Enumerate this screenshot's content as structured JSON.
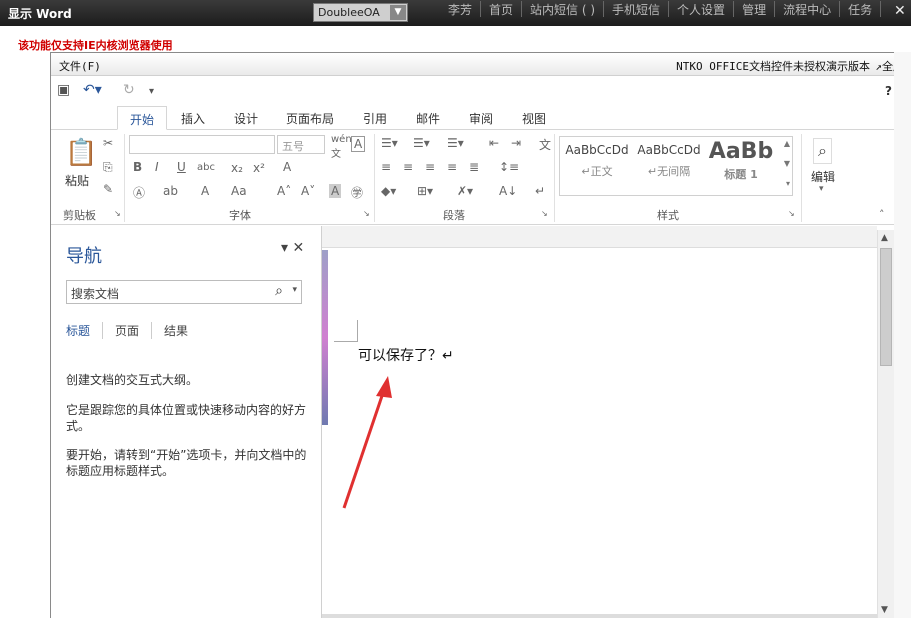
{
  "window": {
    "title": "显示 Word",
    "close": "✕"
  },
  "system_select": {
    "value": "DoubleeOA"
  },
  "top_nav": [
    "李芳",
    "首页",
    "站内短信 ( )",
    "手机短信",
    "个人设置",
    "管理",
    "流程中心",
    "任务"
  ],
  "warning": "该功能仅支持IE内核浏览器使用",
  "menubar": {
    "file": "文件(F)",
    "ntko": "NTKO OFFICE文档控件未授权演示版本",
    "fullscreen": "↗全屏"
  },
  "qat": {
    "help": "?"
  },
  "tabs": [
    "开始",
    "插入",
    "设计",
    "页面布局",
    "引用",
    "邮件",
    "审阅",
    "视图"
  ],
  "ribbon": {
    "clipboard": {
      "paste": "粘贴",
      "label": "剪贴板"
    },
    "font": {
      "size": "五号",
      "label": "字体"
    },
    "paragraph": {
      "label": "段落"
    },
    "styles": {
      "items": [
        {
          "preview": "AaBbCcDd",
          "name": "↵正文"
        },
        {
          "preview": "AaBbCcDd",
          "name": "↵无间隔"
        },
        {
          "preview": "AaBb",
          "name": "标题 1"
        }
      ],
      "label": "样式"
    },
    "editing": {
      "label": "编辑"
    }
  },
  "nav": {
    "title": "导航",
    "search_placeholder": "搜索文档",
    "tabs": [
      "标题",
      "页面",
      "结果"
    ],
    "p1": "创建文档的交互式大纲。",
    "p2": "它是跟踪您的具体位置或快速移动内容的好方式。",
    "p3": "要开始，请转到“开始”选项卡，并向文档中的标题应用标题样式。"
  },
  "document": {
    "text": "可以保存了？↵"
  }
}
